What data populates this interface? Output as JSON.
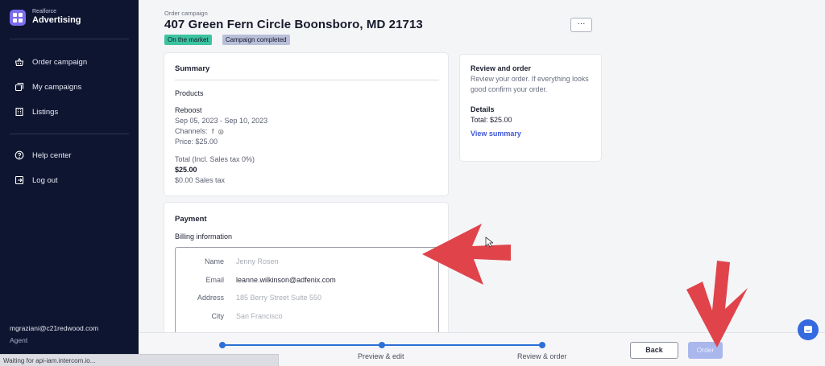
{
  "sidebar": {
    "brand_small": "Realforce",
    "brand_big": "Advertising",
    "items": [
      {
        "label": "Order campaign",
        "icon": "shopping-basket-icon"
      },
      {
        "label": "My campaigns",
        "icon": "copy-icon"
      },
      {
        "label": "Listings",
        "icon": "building-icon"
      },
      {
        "label": "Help center",
        "icon": "help-circle-icon"
      },
      {
        "label": "Log out",
        "icon": "logout-icon"
      }
    ],
    "user_email": "mgraziani@c21redwood.com",
    "user_role": "Agent"
  },
  "header": {
    "breadcrumb": "Order campaign",
    "title": "407 Green Fern Circle Boonsboro, MD 21713",
    "badges": [
      "On the market",
      "Campaign completed"
    ],
    "more_label": "···"
  },
  "summary": {
    "heading": "Summary",
    "products_label": "Products",
    "product_name": "Reboost",
    "date_range": "Sep 05, 2023 - Sep 10, 2023",
    "channels_label": "Channels:",
    "price": "Price: $25.00",
    "total_label": "Total (Incl. Sales tax 0%)",
    "total_value": "$25.00",
    "sales_tax": "$0.00 Sales tax"
  },
  "payment": {
    "heading": "Payment",
    "billing_label": "Billing information",
    "fields": [
      {
        "label": "Name",
        "value": "Jenny Rosen"
      },
      {
        "label": "Email",
        "value": "leanne.wilkinson@adfenix.com"
      },
      {
        "label": "Address",
        "value": "185 Berry Street Suite 550"
      },
      {
        "label": "City",
        "value": "San Francisco"
      }
    ]
  },
  "review": {
    "title": "Review and order",
    "description": "Review your order. If everything looks good confirm your order.",
    "details_label": "Details",
    "total": "Total: $25.00",
    "view_summary": "View summary"
  },
  "footer": {
    "steps": [
      "Preview & edit",
      "Review & order"
    ],
    "back_label": "Back",
    "order_label": "Order"
  },
  "status_bar": "Waiting for api-iam.intercom.io...",
  "colors": {
    "sidebar_bg": "#0e1530",
    "accent": "#2c6fd6",
    "badge_market": "#3cc3a0",
    "badge_completed": "#b9bed9",
    "annotation_arrow": "#e0444a"
  }
}
